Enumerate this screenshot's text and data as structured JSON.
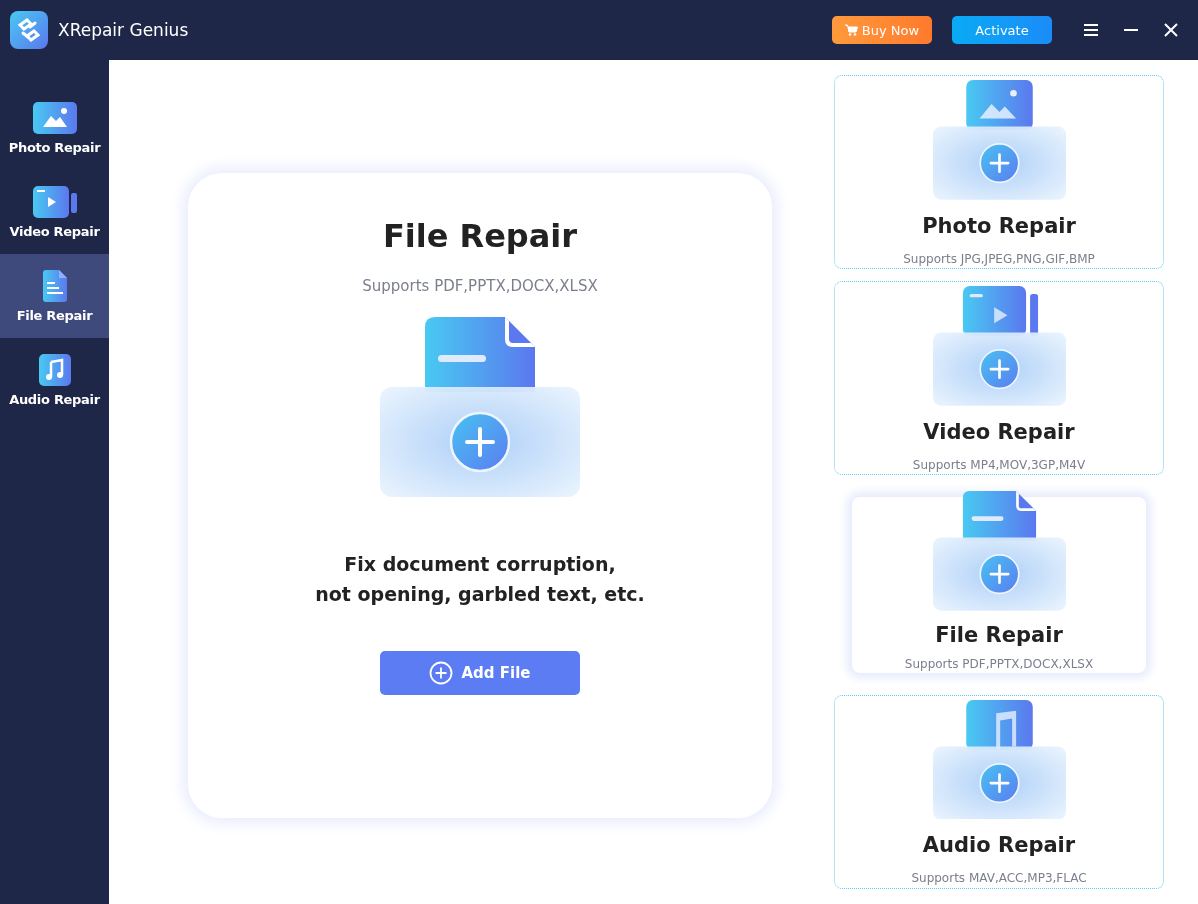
{
  "window": {
    "title": "XRepair Genius"
  },
  "header_buttons": [
    {
      "kind": "buy",
      "label": "Buy Now"
    },
    {
      "kind": "activate",
      "label": "Activate"
    }
  ],
  "sidebar": {
    "items": [
      {
        "kind": "photo",
        "label": "Photo Repair",
        "selected": false
      },
      {
        "kind": "video",
        "label": "Video Repair",
        "selected": false
      },
      {
        "kind": "file",
        "label": "File Repair",
        "selected": true
      },
      {
        "kind": "audio",
        "label": "Audio Repair",
        "selected": false
      }
    ]
  },
  "main_panel": {
    "kind": "file",
    "title": "File Repair",
    "subtitle": "Supports PDF,PPTX,DOCX,XLSX",
    "description": [
      "Fix document corruption,",
      "not opening, garbled text, etc."
    ],
    "button": "Add File"
  },
  "cards": [
    {
      "kind": "photo",
      "title": "Photo Repair",
      "subtitle": "Supports JPG,JPEG,PNG,GIF,BMP",
      "selected": false
    },
    {
      "kind": "video",
      "title": "Video Repair",
      "subtitle": "Supports MP4,MOV,3GP,M4V",
      "selected": false
    },
    {
      "kind": "file",
      "title": "File Repair",
      "subtitle": "Supports PDF,PPTX,DOCX,XLSX",
      "selected": true
    },
    {
      "kind": "audio",
      "title": "Audio Repair",
      "subtitle": "Supports MAV,ACC,MP3,FLAC",
      "selected": false
    }
  ]
}
